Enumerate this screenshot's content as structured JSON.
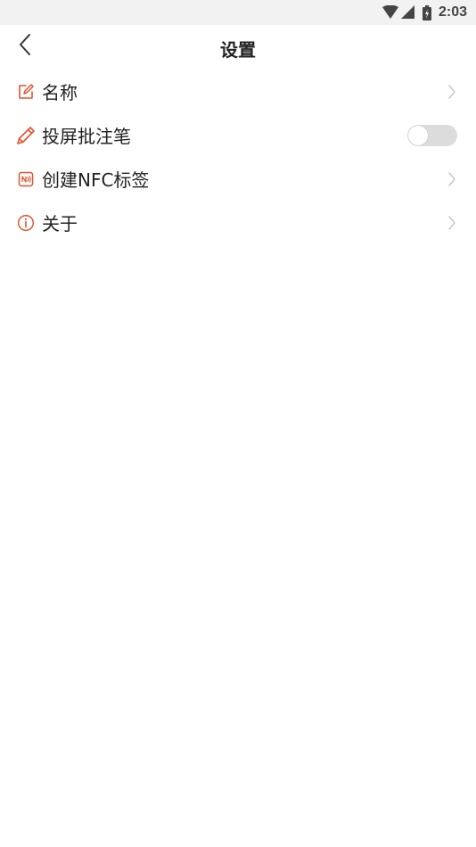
{
  "status_bar": {
    "time": "2:03",
    "icons": [
      "wifi-icon",
      "cell-signal-icon",
      "battery-icon"
    ]
  },
  "header": {
    "title": "设置",
    "back_icon": "chevron-left-icon"
  },
  "settings": {
    "items": [
      {
        "label": "名称",
        "icon": "edit-icon",
        "control": "chevron"
      },
      {
        "label": "投屏批注笔",
        "icon": "pencil-icon",
        "control": "toggle",
        "toggle_on": false
      },
      {
        "label": "创建NFC标签",
        "icon": "nfc-icon",
        "control": "chevron"
      },
      {
        "label": "关于",
        "icon": "info-icon",
        "control": "chevron"
      }
    ]
  },
  "colors": {
    "accent": "#e0532f",
    "chevron": "#c8c8c8",
    "toggle_track": "#dcdcdc",
    "status_bar_bg": "#f2f2f2"
  }
}
